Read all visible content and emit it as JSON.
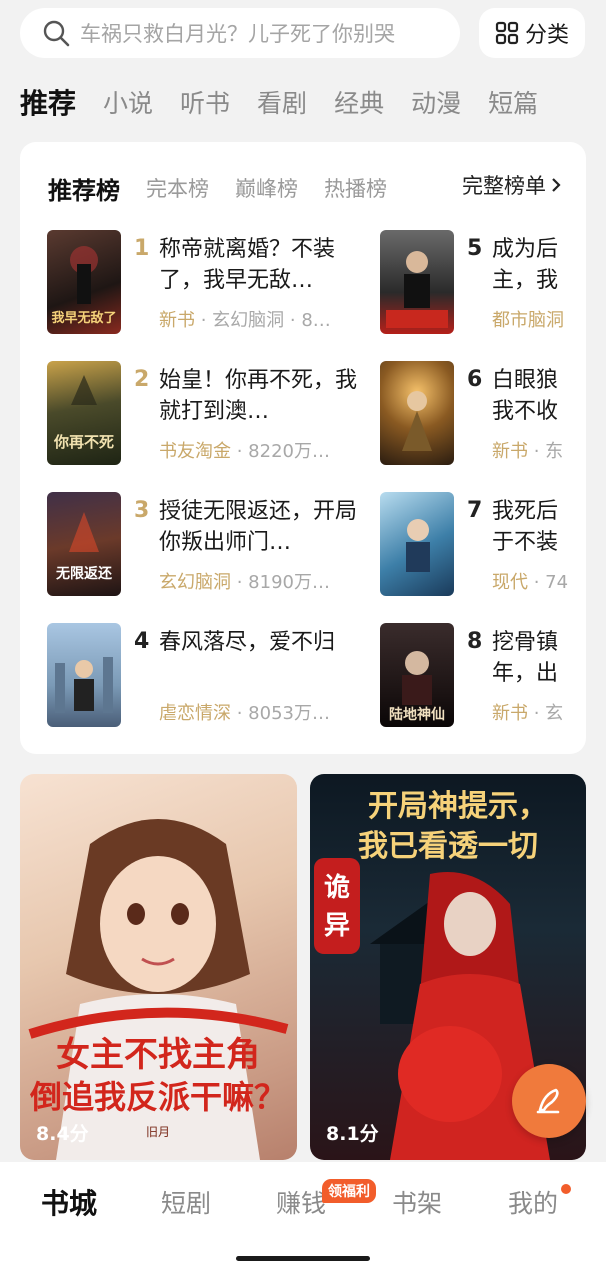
{
  "search": {
    "placeholder": "车祸只救白月光？儿子死了你别哭",
    "category_label": "分类"
  },
  "top_tabs": [
    {
      "label": "推荐",
      "active": true
    },
    {
      "label": "小说",
      "active": false
    },
    {
      "label": "听书",
      "active": false
    },
    {
      "label": "看剧",
      "active": false
    },
    {
      "label": "经典",
      "active": false
    },
    {
      "label": "动漫",
      "active": false
    },
    {
      "label": "短篇",
      "active": false
    }
  ],
  "rank": {
    "tabs": [
      {
        "label": "推荐榜",
        "active": true
      },
      {
        "label": "完本榜",
        "active": false
      },
      {
        "label": "巅峰榜",
        "active": false
      },
      {
        "label": "热播榜",
        "active": false
      }
    ],
    "full_list_label": "完整榜单",
    "items": [
      {
        "num": "1",
        "title": "称帝就离婚？不装了，我早无敌…",
        "tag": "新书",
        "meta": " · 玄幻脑洞 · 8…",
        "cover_color": "#3a2a25"
      },
      {
        "num": "2",
        "title": "始皇！你再不死，我就打到澳…",
        "tag": "书友淘金",
        "meta": " · 8220万…",
        "cover_color": "#2e3520"
      },
      {
        "num": "3",
        "title": "授徒无限返还，开局你叛出师门…",
        "tag": "玄幻脑洞",
        "meta": " · 8190万…",
        "cover_color": "#3a2a2a"
      },
      {
        "num": "4",
        "title": "春风落尽，爱不归",
        "tag": "虐恋情深",
        "meta": " · 8053万…",
        "cover_color": "#7d9ab8"
      },
      {
        "num": "5",
        "title": "成为后",
        "title2": "主，我",
        "tag": "都市脑洞",
        "meta": "",
        "cover_color": "#2a2a2a"
      },
      {
        "num": "6",
        "title": "白眼狼",
        "title2": "我不收",
        "tag": "新书",
        "meta": " · 东",
        "cover_color": "#5a4020"
      },
      {
        "num": "7",
        "title": "我死后",
        "title2": "于不装",
        "tag": "现代",
        "meta": " · 74",
        "cover_color": "#3d7fa8"
      },
      {
        "num": "8",
        "title": "挖骨镇",
        "title2": "年，出",
        "tag": "新书",
        "meta": " · 玄",
        "cover_color": "#2b2020"
      }
    ]
  },
  "big_covers": [
    {
      "score": "8.4分",
      "overlay_text": "女主不找主角 倒追我反派干嘛？",
      "author": "旧月"
    },
    {
      "score": "8.1分",
      "overlay_text": "开局神提示， 我已看透一切",
      "seal": "诡异"
    }
  ],
  "bottom_nav": [
    {
      "label": "书城",
      "active": true
    },
    {
      "label": "短剧",
      "active": false
    },
    {
      "label": "赚钱",
      "active": false,
      "badge": "领福利"
    },
    {
      "label": "书架",
      "active": false
    },
    {
      "label": "我的",
      "active": false,
      "dot": true
    }
  ],
  "colors": {
    "accent_orange": "#f25d2b",
    "gold_rank": "#c9a86a",
    "fab": "#f07a3c"
  }
}
